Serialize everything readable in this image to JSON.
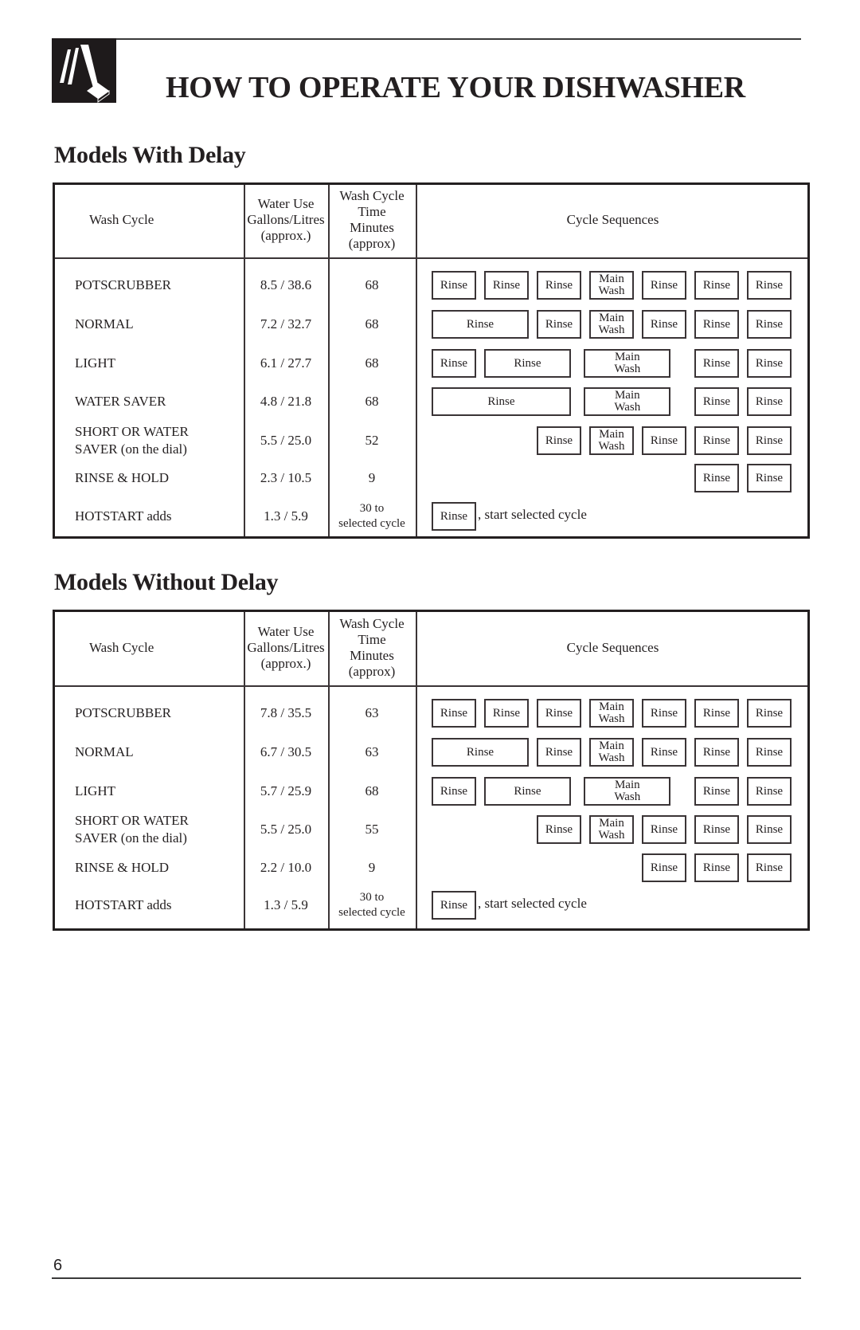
{
  "header": {
    "title": "HOW TO OPERATE YOUR DISHWASHER",
    "logo_icon": "hand-pressing-button-icon"
  },
  "column_headers": {
    "wash_cycle": "Wash Cycle",
    "water_use": "Water Use\nGallons/Litres\n(approx.)",
    "time": "Wash Cycle\nTime\nMinutes\n(approx)",
    "sequences": "Cycle Sequences"
  },
  "sections": [
    {
      "title": "Models With Delay",
      "rows": [
        {
          "cycle": "POTSCRUBBER",
          "water": "8.5 / 38.6",
          "time": "68",
          "sequence": [
            {
              "label": "Rinse",
              "from": 0,
              "span": 1
            },
            {
              "label": "Rinse",
              "from": 1,
              "span": 1
            },
            {
              "label": "Rinse",
              "from": 2,
              "span": 1
            },
            {
              "label": "Main\nWash",
              "from": 3,
              "span": 1
            },
            {
              "label": "Rinse",
              "from": 4,
              "span": 1
            },
            {
              "label": "Rinse",
              "from": 5,
              "span": 1
            },
            {
              "label": "Rinse",
              "from": 6,
              "span": 1
            }
          ]
        },
        {
          "cycle": "NORMAL",
          "water": "7.2 / 32.7",
          "time": "68",
          "sequence": [
            {
              "label": "Rinse",
              "from": 0,
              "span": 2
            },
            {
              "label": "Rinse",
              "from": 2,
              "span": 1
            },
            {
              "label": "Main\nWash",
              "from": 3,
              "span": 1
            },
            {
              "label": "Rinse",
              "from": 4,
              "span": 1
            },
            {
              "label": "Rinse",
              "from": 5,
              "span": 1
            },
            {
              "label": "Rinse",
              "from": 6,
              "span": 1
            }
          ]
        },
        {
          "cycle": "LIGHT",
          "water": "6.1 / 27.7",
          "time": "68",
          "sequence": [
            {
              "label": "Rinse",
              "from": 0,
              "span": 1
            },
            {
              "label": "Rinse",
              "from": 1,
              "span": 1.8
            },
            {
              "label": "Main\nWash",
              "from": 2.9,
              "span": 1.8
            },
            {
              "label": "Rinse",
              "from": 5,
              "span": 1
            },
            {
              "label": "Rinse",
              "from": 6,
              "span": 1
            }
          ]
        },
        {
          "cycle": "WATER SAVER",
          "water": "4.8 / 21.8",
          "time": "68",
          "sequence": [
            {
              "label": "Rinse",
              "from": 0,
              "span": 2.8
            },
            {
              "label": "Main\nWash",
              "from": 2.9,
              "span": 1.8
            },
            {
              "label": "Rinse",
              "from": 5,
              "span": 1
            },
            {
              "label": "Rinse",
              "from": 6,
              "span": 1
            }
          ]
        },
        {
          "cycle": "SHORT OR WATER\nSAVER (on the dial)",
          "water": "5.5 / 25.0",
          "time": "52",
          "sequence": [
            {
              "label": "Rinse",
              "from": 2,
              "span": 1
            },
            {
              "label": "Main\nWash",
              "from": 3,
              "span": 1
            },
            {
              "label": "Rinse",
              "from": 4,
              "span": 1
            },
            {
              "label": "Rinse",
              "from": 5,
              "span": 1
            },
            {
              "label": "Rinse",
              "from": 6,
              "span": 1
            }
          ]
        },
        {
          "cycle": "RINSE & HOLD",
          "water": "2.3 / 10.5",
          "time": "9",
          "sequence": [
            {
              "label": "Rinse",
              "from": 5,
              "span": 1
            },
            {
              "label": "Rinse",
              "from": 6,
              "span": 1
            }
          ]
        },
        {
          "cycle": "HOTSTART adds",
          "water": "1.3 / 5.9",
          "time": "30 to\nselected cycle",
          "sequence": [
            {
              "label": "Rinse",
              "from": 0,
              "span": 1
            }
          ],
          "note": ", start selected cycle"
        }
      ]
    },
    {
      "title": "Models Without Delay",
      "rows": [
        {
          "cycle": "POTSCRUBBER",
          "water": "7.8 / 35.5",
          "time": "63",
          "sequence": [
            {
              "label": "Rinse",
              "from": 0,
              "span": 1
            },
            {
              "label": "Rinse",
              "from": 1,
              "span": 1
            },
            {
              "label": "Rinse",
              "from": 2,
              "span": 1
            },
            {
              "label": "Main\nWash",
              "from": 3,
              "span": 1
            },
            {
              "label": "Rinse",
              "from": 4,
              "span": 1
            },
            {
              "label": "Rinse",
              "from": 5,
              "span": 1
            },
            {
              "label": "Rinse",
              "from": 6,
              "span": 1
            }
          ]
        },
        {
          "cycle": "NORMAL",
          "water": "6.7 / 30.5",
          "time": "63",
          "sequence": [
            {
              "label": "Rinse",
              "from": 0,
              "span": 2
            },
            {
              "label": "Rinse",
              "from": 2,
              "span": 1
            },
            {
              "label": "Main\nWash",
              "from": 3,
              "span": 1
            },
            {
              "label": "Rinse",
              "from": 4,
              "span": 1
            },
            {
              "label": "Rinse",
              "from": 5,
              "span": 1
            },
            {
              "label": "Rinse",
              "from": 6,
              "span": 1
            }
          ]
        },
        {
          "cycle": "LIGHT",
          "water": "5.7 / 25.9",
          "time": "68",
          "sequence": [
            {
              "label": "Rinse",
              "from": 0,
              "span": 1
            },
            {
              "label": "Rinse",
              "from": 1,
              "span": 1.8
            },
            {
              "label": "Main\nWash",
              "from": 2.9,
              "span": 1.8
            },
            {
              "label": "Rinse",
              "from": 5,
              "span": 1
            },
            {
              "label": "Rinse",
              "from": 6,
              "span": 1
            }
          ]
        },
        {
          "cycle": "SHORT OR WATER\nSAVER (on the dial)",
          "water": "5.5 / 25.0",
          "time": "55",
          "sequence": [
            {
              "label": "Rinse",
              "from": 2,
              "span": 1
            },
            {
              "label": "Main\nWash",
              "from": 3,
              "span": 1
            },
            {
              "label": "Rinse",
              "from": 4,
              "span": 1
            },
            {
              "label": "Rinse",
              "from": 5,
              "span": 1
            },
            {
              "label": "Rinse",
              "from": 6,
              "span": 1
            }
          ]
        },
        {
          "cycle": "RINSE & HOLD",
          "water": "2.2 / 10.0",
          "time": "9",
          "sequence": [
            {
              "label": "Rinse",
              "from": 4,
              "span": 1
            },
            {
              "label": "Rinse",
              "from": 5,
              "span": 1
            },
            {
              "label": "Rinse",
              "from": 6,
              "span": 1
            }
          ]
        },
        {
          "cycle": "HOTSTART adds",
          "water": "1.3 / 5.9",
          "time": "30 to\nselected cycle",
          "sequence": [
            {
              "label": "Rinse",
              "from": 0,
              "span": 1
            }
          ],
          "note": ", start selected cycle"
        }
      ]
    }
  ],
  "footer": {
    "page_number": "6"
  }
}
